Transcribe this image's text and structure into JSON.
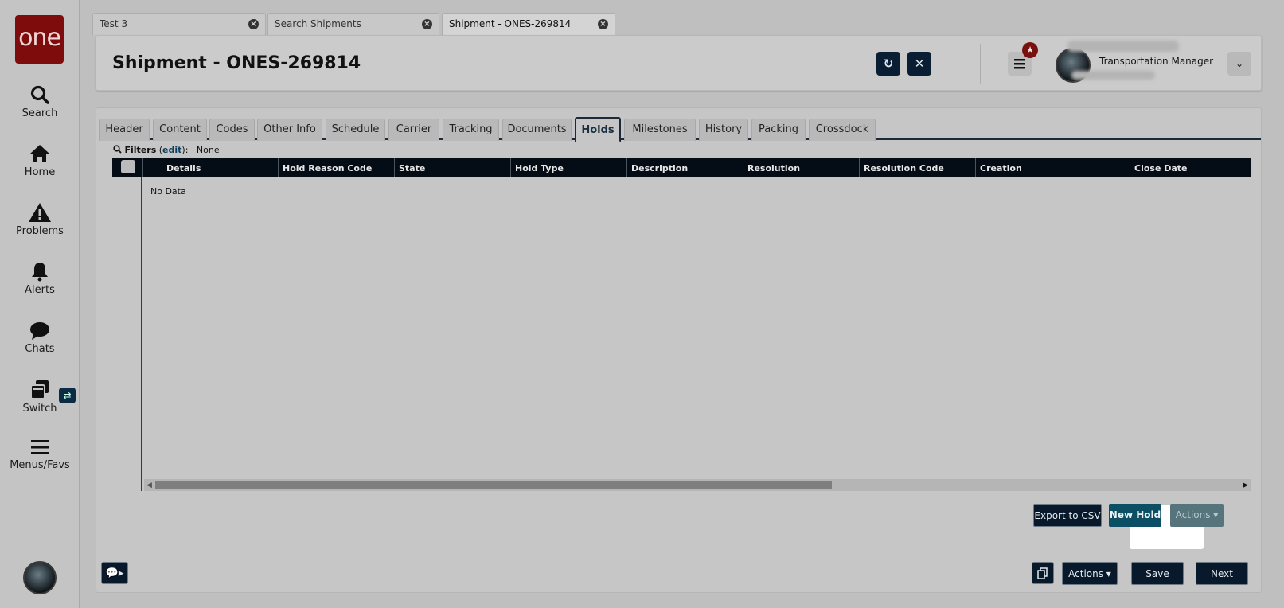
{
  "logo": {
    "text": "one"
  },
  "nav": [
    {
      "label": "Search",
      "icon": "search-icon"
    },
    {
      "label": "Home",
      "icon": "home-icon"
    },
    {
      "label": "Problems",
      "icon": "warning-icon"
    },
    {
      "label": "Alerts",
      "icon": "bell-icon"
    },
    {
      "label": "Chats",
      "icon": "chat-icon"
    },
    {
      "label": "Switch",
      "icon": "switch-icon"
    },
    {
      "label": "Menus/Favs",
      "icon": "menu-icon"
    }
  ],
  "switch_badge": "⇄",
  "doc_tabs": [
    {
      "label": "Test 3"
    },
    {
      "label": "Search Shipments"
    },
    {
      "label": "Shipment - ONES-269814",
      "active": true
    }
  ],
  "header": {
    "title": "Shipment - ONES-269814",
    "refresh_icon": "↻",
    "close_icon": "✕",
    "star_icon": "★",
    "role": "Transportation Manager",
    "dropdown_icon": "⌄"
  },
  "tabs": [
    "Header",
    "Content",
    "Codes",
    "Other Info",
    "Schedule",
    "Carrier",
    "Tracking",
    "Documents",
    "Holds",
    "Milestones",
    "History",
    "Packing",
    "Crossdock"
  ],
  "active_tab": "Holds",
  "filters": {
    "label": "Filters",
    "edit": "edit",
    "value": "None"
  },
  "grid": {
    "columns": [
      "Details",
      "Hold Reason Code",
      "State",
      "Hold Type",
      "Description",
      "Resolution",
      "Resolution Code",
      "Creation",
      "Close Date"
    ],
    "empty_text": "No Data"
  },
  "buttons": {
    "export_csv": "Export to CSV",
    "new_hold": "New Hold",
    "actions_top": "Actions ▾",
    "actions_bottom": "Actions ▾",
    "save": "Save",
    "next": "Next",
    "chat_icon": "💬▸"
  },
  "colors": {
    "accent": "#0c4e63",
    "dark": "#08192b",
    "brand": "#7e0c0c"
  }
}
